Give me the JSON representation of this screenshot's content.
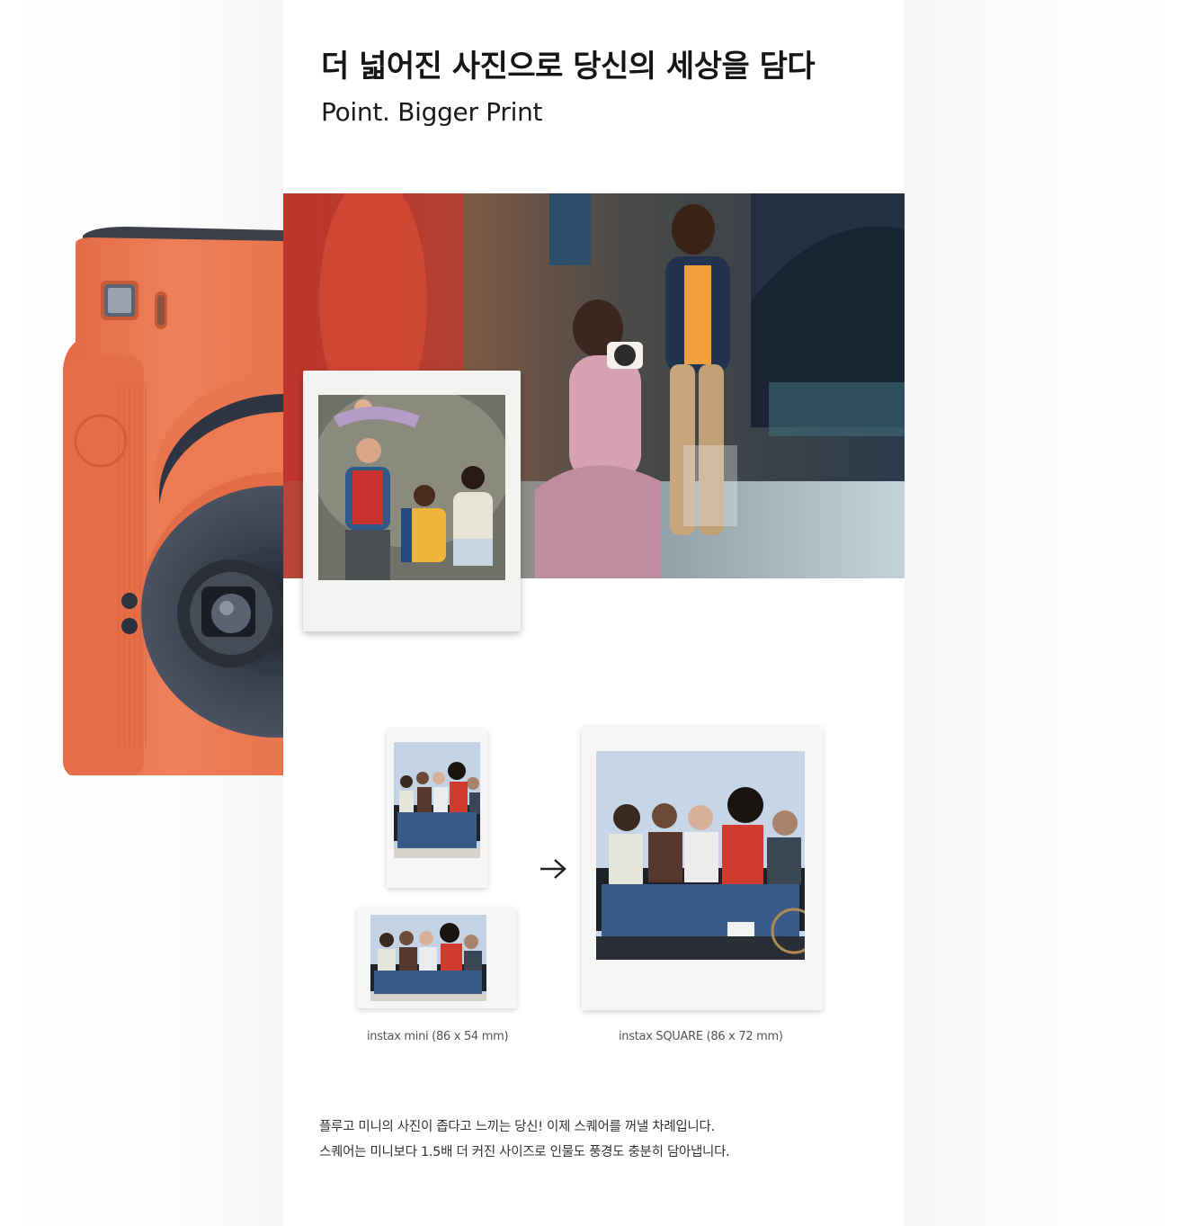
{
  "section": {
    "headline": "더 넓어진 사진으로 당신의 세상을 담다",
    "subhead": "Point. Bigger Print"
  },
  "comparison": {
    "mini_caption": "instax mini (86 x 54 mm)",
    "square_caption": "instax SQUARE (86 x 72 mm)",
    "arrow_icon": "arrow-right-icon"
  },
  "description": {
    "line1": "플루고 미니의 사진이 좁다고 느끼는 당신! 이제 스퀘어를 꺼낼 차례입니다.",
    "line2": "스퀘어는 미니보다 1.5배 더 커진 사이즈로 인물도 풍경도 충분히 담아냅니다."
  },
  "colors": {
    "camera_body": "#e8744f",
    "camera_lens": "#3a4150",
    "text_primary": "#151515",
    "text_secondary": "#555555"
  }
}
